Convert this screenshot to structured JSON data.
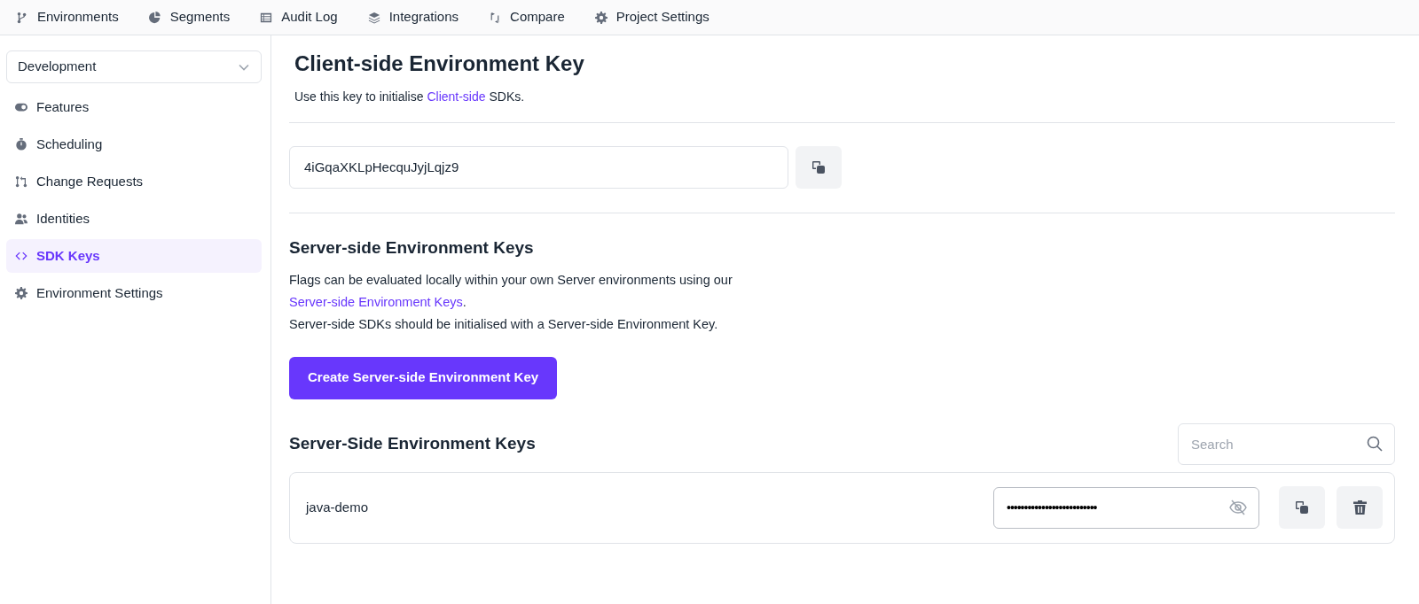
{
  "top_nav": [
    {
      "label": "Environments"
    },
    {
      "label": "Segments"
    },
    {
      "label": "Audit Log"
    },
    {
      "label": "Integrations"
    },
    {
      "label": "Compare"
    },
    {
      "label": "Project Settings"
    }
  ],
  "sidebar": {
    "environment_select": {
      "value": "Development"
    },
    "items": [
      {
        "label": "Features",
        "selected": false
      },
      {
        "label": "Scheduling",
        "selected": false
      },
      {
        "label": "Change Requests",
        "selected": false
      },
      {
        "label": "Identities",
        "selected": false
      },
      {
        "label": "SDK Keys",
        "selected": true
      },
      {
        "label": "Environment Settings",
        "selected": false
      }
    ]
  },
  "client_key": {
    "title": "Client-side Environment Key",
    "description": [
      [
        {
          "kind": "text",
          "text": "Use this key to initialise "
        },
        {
          "kind": "link",
          "text": "Client-side"
        },
        {
          "kind": "text",
          "text": " SDKs."
        }
      ]
    ],
    "value": "4iGqaXKLpHecquJyjLqjz9"
  },
  "server_keys": {
    "title": "Server-side Environment Keys",
    "description": [
      [
        {
          "kind": "text",
          "text": "Flags can be evaluated locally within your own Server environments using our"
        }
      ],
      [
        {
          "kind": "link",
          "text": "Server-side Environment Keys"
        },
        {
          "kind": "text",
          "text": "."
        }
      ],
      [
        {
          "kind": "text",
          "text": "Server-side SDKs should be initialised with a Server-side Environment Key."
        }
      ]
    ],
    "create_button": "Create Server-side Environment Key",
    "list_title": "Server-Side Environment Keys",
    "search": {
      "placeholder": "Search"
    },
    "keys": [
      {
        "name": "java-demo",
        "masked_value": "••••••••••••••••••••••••••"
      }
    ]
  }
}
